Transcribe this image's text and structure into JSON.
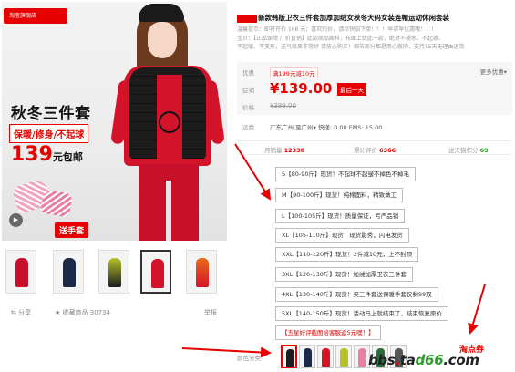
{
  "product": {
    "title": "新款韩版卫衣三件套加厚加绒女秋冬大码女装连帽运动休闲套装",
    "notice_lines": [
      "温馨提示：即将开价 168 元；喜欢的价，请尽快加下单！！！早买早优惠哦！！！",
      "宝贝：【正品保障 厂价直销】此款商品面料，布面上优此一款，绝对不褪水、不起球、",
      "不起皱、不变形，送气效果非常好 请放心购买！细节部分都是用心做的，支持15天无理由退货"
    ],
    "promo_label": "优惠",
    "promo_tag": "满199元减10元",
    "more_deals": "更多优惠▾",
    "price_label": "促销",
    "price": "¥139.00",
    "last_day": "最后一天",
    "orig_price_label": "价格",
    "orig_price": "¥399.00",
    "ship_label": "运费",
    "ship_info": "广东广州  至广州▾  快递: 0.00  EMS: 15.00"
  },
  "stats": {
    "monthly_label": "月销量",
    "monthly": "12330",
    "total_label": "累计评价",
    "total": "6366",
    "points_label": "送天猫积分",
    "points": "69"
  },
  "sizes": [
    {
      "size": "S【80-90斤】",
      "note": "现货！不起球不起皱不掉色不掉毛"
    },
    {
      "size": "M【90-100斤】",
      "note": "现货！纯棉面料，精致做工"
    },
    {
      "size": "L【100-105斤】",
      "note": "现货！质量保证，亏严品销"
    },
    {
      "size": "XL【105-110斤】",
      "note": "现货！现货影秀，闪电发货"
    },
    {
      "size": "XXL【110-120斤】",
      "note": "现货！2件减10元，上不封顶"
    },
    {
      "size": "3XL【120-130斤】",
      "note": "现货！加绒加厚卫衣三件套"
    },
    {
      "size": "4XL【130-140斤】",
      "note": "现货！买三件套送保暖手套仅剩99双"
    },
    {
      "size": "5XL【140-150斤】",
      "note": "现货！活动马上就结束了，结束恢复原价"
    },
    {
      "size": "【五星好评截图给客服返5元噢！】",
      "note": ""
    }
  ],
  "colors_label": "颜色分类",
  "main_image": {
    "shop_logo": "淘宝旗舰店",
    "promo_title": "秋冬三件套",
    "promo_sub": "保暖/修身/不起球",
    "promo_price": "139",
    "promo_price_unit": "元包邮",
    "glove_badge": "送手套"
  },
  "share": {
    "share_label": "分享",
    "fav_label": "收藏商品 30734",
    "report_label": "举报"
  },
  "watermark": {
    "top": "淘点券",
    "main_prefix": "bbs",
    "main_red": ".",
    "main_mid": "ta",
    "main_green": "d66",
    "main_suffix": ".com"
  },
  "colors": {
    "accent": "#e60000",
    "hoodie_red": "#d3132a",
    "vest_black": "#1c1c1c",
    "green": "#2c9d2c"
  }
}
